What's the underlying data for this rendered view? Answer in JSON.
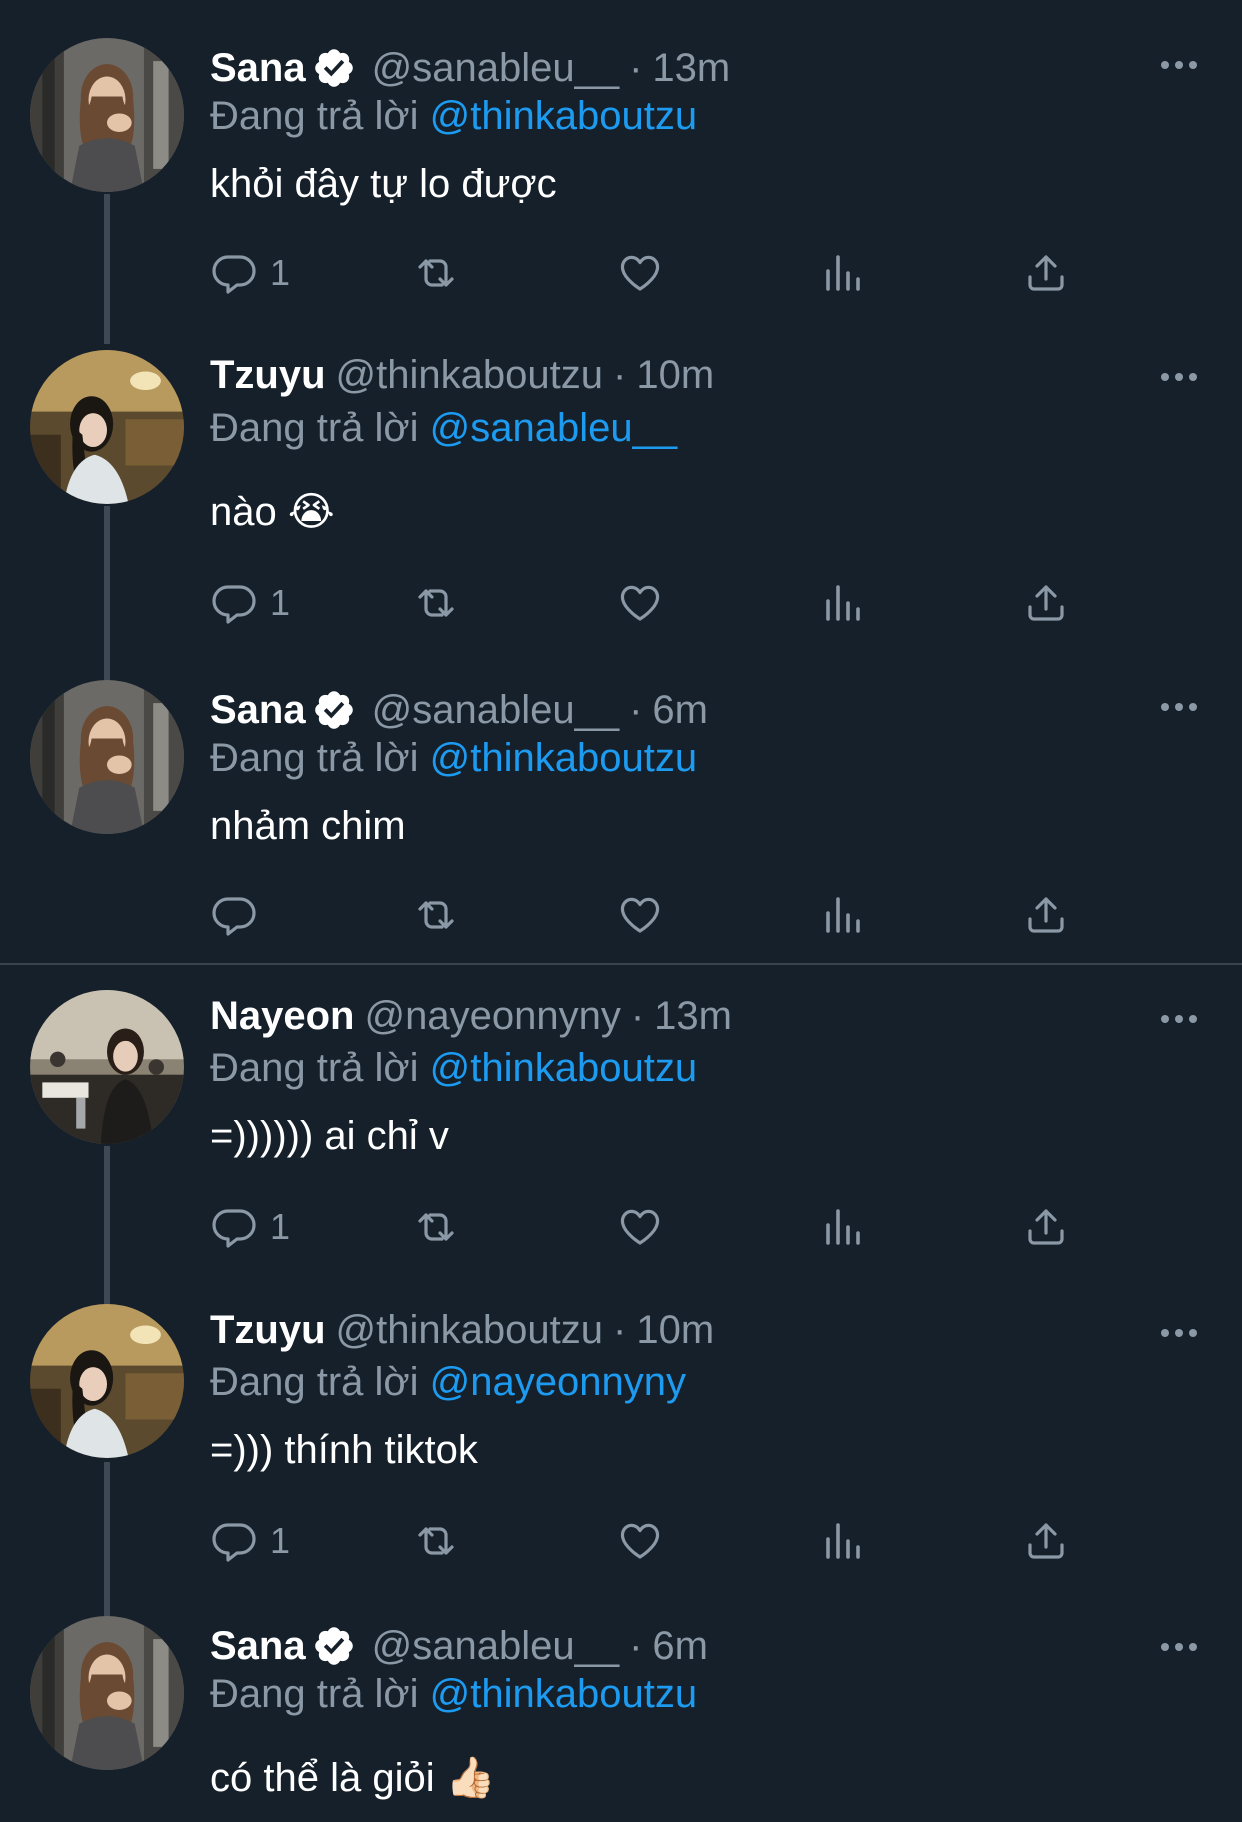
{
  "tweets": [
    {
      "name": "Sana",
      "verified": true,
      "handle": "@sanableu__",
      "time": "13m",
      "reply_prefix": "Đang trả lời",
      "reply_to": "@thinkaboutzu",
      "text": "khỏi đây tự lo được",
      "reply_count": "1",
      "avatar": "sana"
    },
    {
      "name": "Tzuyu",
      "verified": false,
      "handle": "@thinkaboutzu",
      "time": "10m",
      "reply_prefix": "Đang trả lời",
      "reply_to": "@sanableu__",
      "text": "nào 😭",
      "reply_count": "1",
      "avatar": "tzuyu"
    },
    {
      "name": "Sana",
      "verified": true,
      "handle": "@sanableu__",
      "time": "6m",
      "reply_prefix": "Đang trả lời",
      "reply_to": "@thinkaboutzu",
      "text": "nhảm chim",
      "reply_count": "",
      "avatar": "sana"
    },
    {
      "name": "Nayeon",
      "verified": false,
      "handle": "@nayeonnyny",
      "time": "13m",
      "reply_prefix": "Đang trả lời",
      "reply_to": "@thinkaboutzu",
      "text": "=)))))) ai chỉ v",
      "reply_count": "1",
      "avatar": "nayeon"
    },
    {
      "name": "Tzuyu",
      "verified": false,
      "handle": "@thinkaboutzu",
      "time": "10m",
      "reply_prefix": "Đang trả lời",
      "reply_to": "@nayeonnyny",
      "text": "=))) thính tiktok",
      "reply_count": "1",
      "avatar": "tzuyu"
    },
    {
      "name": "Sana",
      "verified": true,
      "handle": "@sanableu__",
      "time": "6m",
      "reply_prefix": "Đang trả lời",
      "reply_to": "@thinkaboutzu",
      "text": "có thể là giỏi 👍🏻",
      "reply_count": "",
      "avatar": "sana"
    }
  ],
  "colors": {
    "background": "#15202b",
    "secondary_text": "#8b98a5",
    "accent": "#1d9bf0",
    "divider": "#38444d"
  },
  "icons": [
    "reply-icon",
    "retweet-icon",
    "like-icon",
    "views-icon",
    "share-icon",
    "more-icon",
    "verified-icon"
  ]
}
